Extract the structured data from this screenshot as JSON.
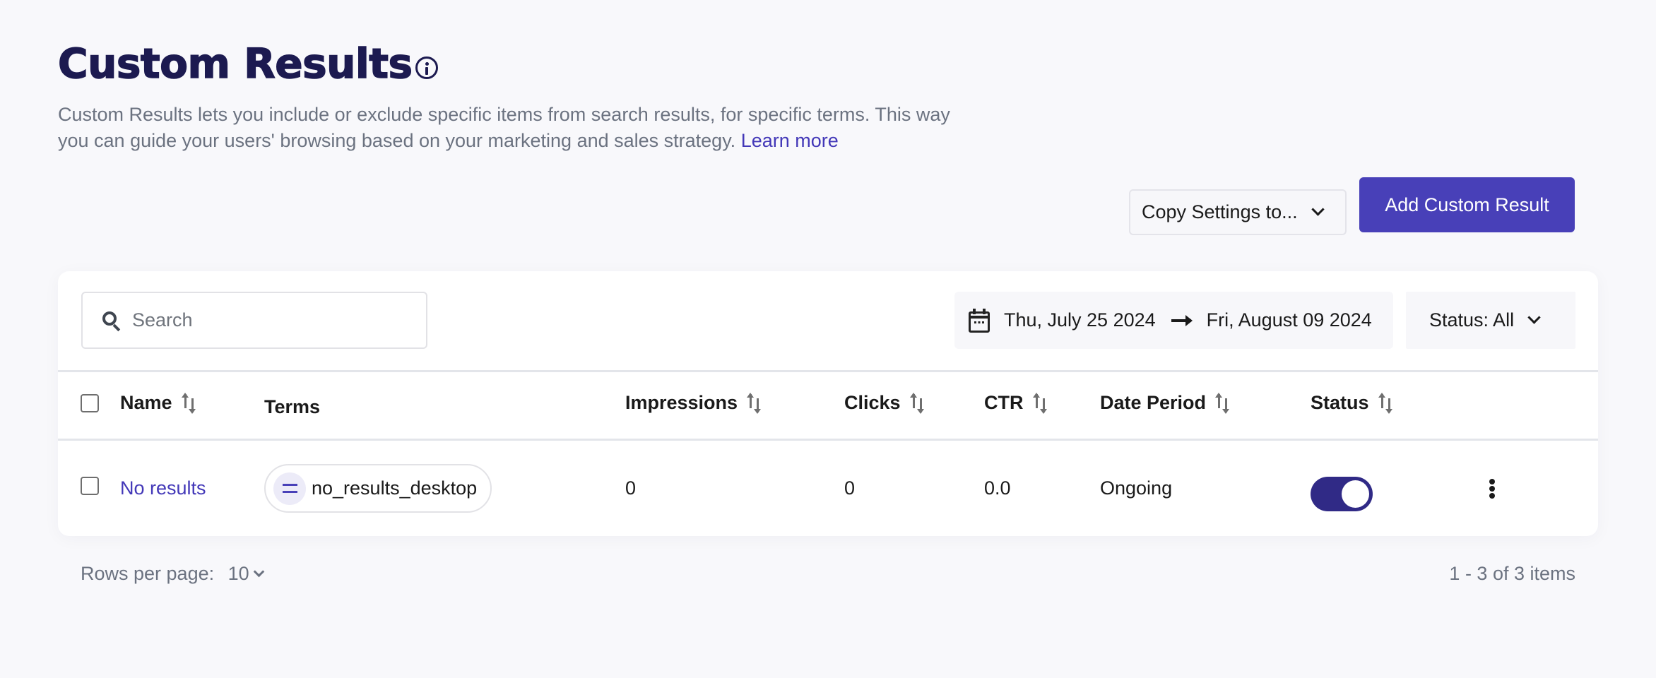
{
  "header": {
    "title": "Custom Results",
    "description": "Custom Results lets you include or exclude specific items from search results, for specific terms. This way you can guide your users' browsing based on your marketing and sales strategy.",
    "learn_more": "Learn more"
  },
  "actions": {
    "copy_settings_label": "Copy Settings to...",
    "add_label": "Add Custom Result"
  },
  "filters": {
    "search_placeholder": "Search",
    "search_value": "",
    "date_start": "Thu, July 25 2024",
    "date_end": "Fri, August 09 2024",
    "status_label": "Status: All"
  },
  "table": {
    "columns": {
      "name": "Name",
      "terms": "Terms",
      "impressions": "Impressions",
      "clicks": "Clicks",
      "ctr": "CTR",
      "date_period": "Date Period",
      "status": "Status"
    },
    "rows": [
      {
        "name": "No results",
        "term": "no_results_desktop",
        "impressions": "0",
        "clicks": "0",
        "ctr": "0.0",
        "date_period": "Ongoing",
        "status_enabled": true
      }
    ]
  },
  "footer": {
    "rows_per_page_label": "Rows per page:",
    "rows_per_page_value": "10",
    "range_text": "1 - 3 of 3 items"
  },
  "colors": {
    "brand_dark": "#1c1a50",
    "accent": "#4840b8",
    "link": "#4338b8",
    "toggle_on": "#302a86",
    "background": "#f8f8fb"
  }
}
